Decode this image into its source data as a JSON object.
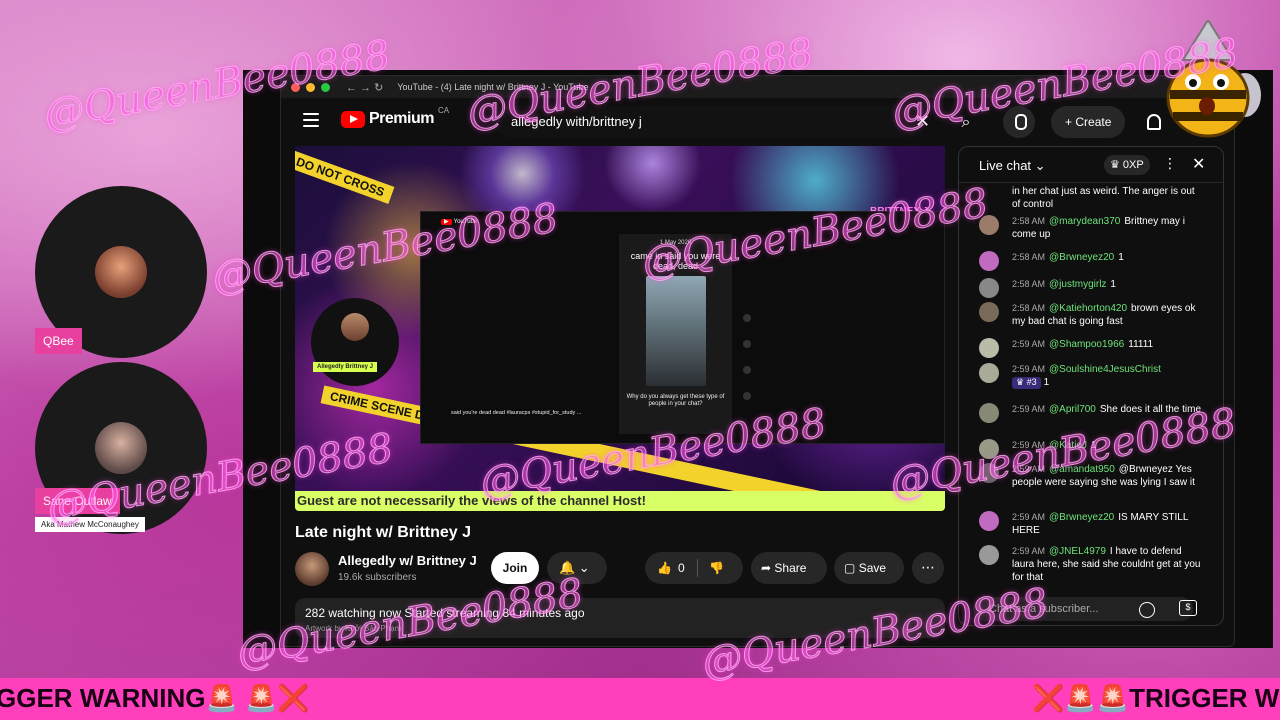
{
  "watermark": "@QueenBee0888",
  "browser": {
    "tab_title": "YouTube - (4) Late night w/ Brittney J - YouTube",
    "nav_arrows": "← →  ↻"
  },
  "youtube": {
    "logo_text": "Premium",
    "logo_region": "CA",
    "search_query": "allegedly with/brittney j",
    "clear_icon": "✕",
    "search_icon": "⌕",
    "create_label": "Create",
    "create_icon": "+"
  },
  "player": {
    "crime_tape_top": "S DO NOT CROSS",
    "crime_tape_bottom": "CRIME SCENE DO NOT CROSS",
    "channel_logo": "BRITTNEY J",
    "guest_tag": "Allegedly Brittney J",
    "banner": "Guest are not necessarily the views of the channel Host!",
    "inner": {
      "yt_label": "YouTube",
      "date": "1 May 2026",
      "caption": "came in said you were dead, dead",
      "question": "Why do you always get these type of people in your chat?",
      "desc": "said you're dead dead #lauracps #stupid_for_study ..."
    }
  },
  "video": {
    "title": "Late night w/ Brittney J",
    "channel": "Allegedly w/ Brittney J",
    "subscribers": "19.6k subscribers",
    "join_label": "Join",
    "bell_label": "🔔 ⌄",
    "like_count": "0",
    "like_icon": "👍",
    "dislike_icon": "👎",
    "share_label": "Share",
    "share_icon": "➦",
    "save_label": "Save",
    "save_icon": "▢",
    "more_icon": "⋯",
    "stats": "282 watching now  Started streaming 84 minutes ago",
    "credit": "Artwork by Khởi Bảo Phạm"
  },
  "chat": {
    "title": "Live chat ⌄",
    "xp": "♛ 0XP",
    "dots": "⋮",
    "close": "✕",
    "input_placeholder": "Chat as a subscriber...",
    "dollar": "$",
    "first_text": "in her chat just as weird. The anger is out of control",
    "messages": [
      {
        "time": "2:58 AM",
        "author": "@marydean370",
        "text": "Brittney may i come up",
        "color": "#9b7b6a"
      },
      {
        "time": "2:58 AM",
        "author": "@Brwneyez20",
        "text": "1",
        "color": "#c06ac0"
      },
      {
        "time": "2:58 AM",
        "author": "@justmygirlz",
        "text": "1",
        "color": "#888"
      },
      {
        "time": "2:58 AM",
        "author": "@Katiehorton420",
        "text": "brown eyes ok my bad chat is going fast",
        "color": "#7a6a5a"
      },
      {
        "time": "2:59 AM",
        "author": "@Shampoo1966",
        "text": "11111",
        "color": "#bba"
      },
      {
        "time": "2:59 AM",
        "author": "@Soulshine4JesusChrist",
        "badge": "♛ #3",
        "text": "1",
        "color": "#aa9"
      },
      {
        "time": "2:59 AM",
        "author": "@April700",
        "text": "She does it all the time",
        "color": "#887"
      },
      {
        "time": "2:59 AM",
        "author": "@KatieJ",
        "text": "1",
        "color": "#998"
      },
      {
        "time": "2:59 AM",
        "author": "@amandat950",
        "text": "@Brwneyez Yes people were saying she was lying I saw it",
        "color": "#666"
      },
      {
        "time": "2:59 AM",
        "author": "@Brwneyez20",
        "text": "IS MARY STILL HERE",
        "color": "#c06ac0"
      },
      {
        "time": "2:59 AM",
        "author": "@JNEL4979",
        "text": "I have to defend laura here, she said she couldnt get at you for that",
        "color": "#999"
      }
    ]
  },
  "sidebar": {
    "host_tag": "QBee",
    "guest_tag": "Sane Outlaw",
    "guest_sub": "Aka Mathew McConaughey"
  },
  "trigger": {
    "left": "GGER WARNING🚨 🚨❌",
    "right": "❌🚨🚨TRIGGER W"
  }
}
